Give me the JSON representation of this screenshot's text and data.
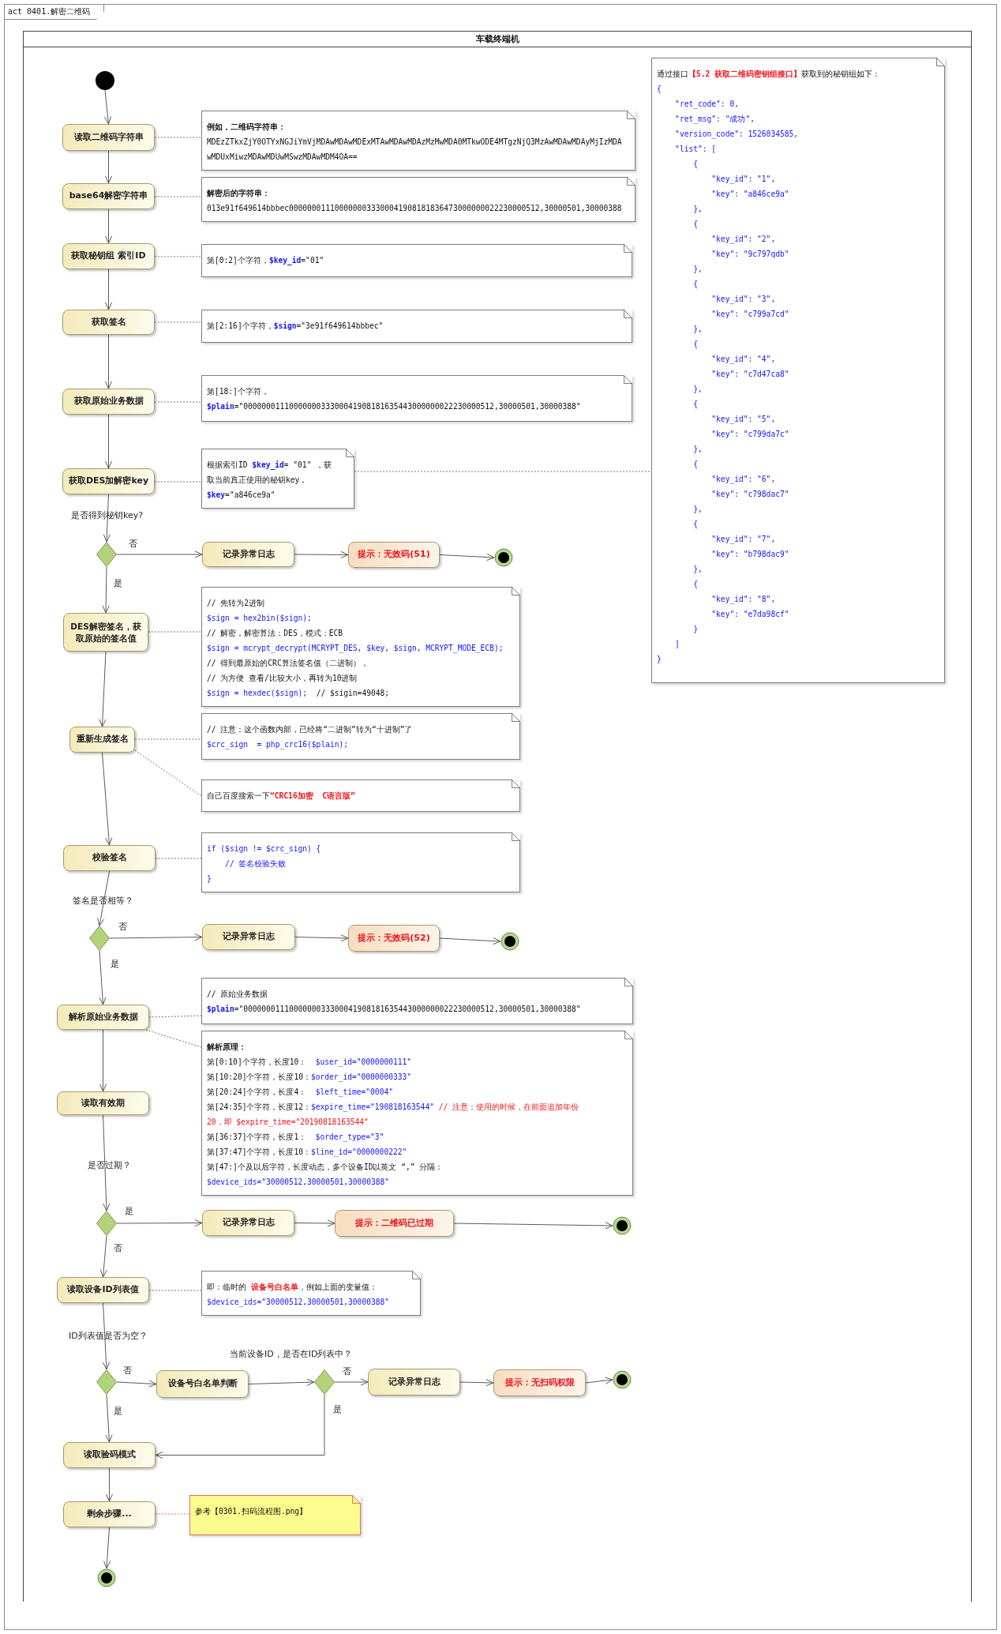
{
  "frame": {
    "title": "act 0401.解密二维码"
  },
  "swimlane": {
    "title": "车载终端机"
  },
  "nodes": [
    {
      "kind": "start"
    },
    {
      "kind": "action",
      "label": "读取二维码字符串"
    },
    {
      "kind": "action",
      "label": "base64解密字符串"
    },
    {
      "kind": "action",
      "label": "获取秘钥组 索引ID"
    },
    {
      "kind": "action",
      "label": "获取签名"
    },
    {
      "kind": "action",
      "label": "获取原始业务数据"
    },
    {
      "kind": "action",
      "label": "获取DES加解密key"
    },
    {
      "kind": "decision"
    },
    {
      "kind": "action",
      "label": "记录异常日志"
    },
    {
      "kind": "alert",
      "label": "提示：无效码(51)"
    },
    {
      "kind": "end"
    },
    {
      "kind": "action",
      "label": "DES解密签名，获取原始的签名值"
    },
    {
      "kind": "action",
      "label": "重新生成签名"
    },
    {
      "kind": "action",
      "label": "校验签名"
    },
    {
      "kind": "decision"
    },
    {
      "kind": "action",
      "label": "记录异常日志"
    },
    {
      "kind": "alert",
      "label": "提示：无效码(52)"
    },
    {
      "kind": "end"
    },
    {
      "kind": "action",
      "label": "解析原始业务数据"
    },
    {
      "kind": "action",
      "label": "读取有效期"
    },
    {
      "kind": "decision"
    },
    {
      "kind": "action",
      "label": "记录异常日志"
    },
    {
      "kind": "alert",
      "label": "提示：二维码已过期"
    },
    {
      "kind": "end"
    },
    {
      "kind": "action",
      "label": "读取设备ID列表值"
    },
    {
      "kind": "decision"
    },
    {
      "kind": "action",
      "label": "设备号白名单判断"
    },
    {
      "kind": "decision"
    },
    {
      "kind": "action",
      "label": "记录异常日志"
    },
    {
      "kind": "alert",
      "label": "提示：无扫码权限"
    },
    {
      "kind": "end"
    },
    {
      "kind": "action",
      "label": "读取验码模式"
    },
    {
      "kind": "action",
      "label": "剩余步骤..."
    },
    {
      "kind": "end"
    }
  ],
  "notes": [
    {
      "kind": "note",
      "lines": [
        [
          {
            "kind": "heading",
            "text": "例如，二维码字符串："
          }
        ],
        [
          {
            "kind": "text",
            "text": "MDEzZTkxZjY0OTYxNGJiYmVjMDAwMDAwMDExMTAwMDAwMDAzMzMwMDA0MTkwODE4MTgzNjQ3MzAwMDAwMDAyMjIzMDA"
          }
        ],
        [
          {
            "kind": "text",
            "text": "wMDUxMiwzMDAwMDUwMSwzMDAwMDM4OA=="
          }
        ]
      ]
    },
    {
      "kind": "note",
      "lines": [
        [
          {
            "kind": "heading",
            "text": "解密后的字符串："
          }
        ],
        [
          {
            "kind": "text",
            "text": "013e91f649614bbbec0000000111000000033300041908181836473000000022230000512,30000501,30000388"
          }
        ]
      ]
    },
    {
      "kind": "note",
      "lines": [
        [
          {
            "kind": "text",
            "text": "第[0:2]个字符，"
          },
          {
            "kind": "var",
            "text": "$key_id"
          },
          {
            "kind": "text",
            "text": "=\"01\""
          }
        ]
      ]
    },
    {
      "kind": "note",
      "lines": [
        [
          {
            "kind": "text",
            "text": "第[2:16]个字符，"
          },
          {
            "kind": "var",
            "text": "$sign"
          },
          {
            "kind": "text",
            "text": "=\"3e91f649614bbbec\""
          }
        ]
      ]
    },
    {
      "kind": "note",
      "lines": [
        [
          {
            "kind": "text",
            "text": "第[18:]个字符，"
          }
        ],
        [
          {
            "kind": "var",
            "text": "$plain"
          },
          {
            "kind": "text",
            "text": "=\"0000000111000000033300041908181635443000000022230000512,30000501,30000388\""
          }
        ]
      ]
    },
    {
      "kind": "note",
      "lines": [
        [
          {
            "kind": "text",
            "text": "根据索引ID "
          },
          {
            "kind": "var",
            "text": "$key_id"
          },
          {
            "kind": "text",
            "text": "= \"01\" ，获"
          }
        ],
        [
          {
            "kind": "text",
            "text": "取当前真正使用的秘钥key，"
          }
        ],
        [
          {
            "kind": "var",
            "text": "$key"
          },
          {
            "kind": "text",
            "text": "=\"a846ce9a\""
          }
        ]
      ]
    },
    {
      "kind": "note",
      "lines": [
        [
          {
            "kind": "text",
            "text": "通过接口"
          },
          {
            "kind": "alert",
            "text": "【5.2 获取二维码密钥组接口】"
          },
          {
            "kind": "text",
            "text": "获取到的秘钥组如下："
          }
        ],
        [
          {
            "kind": "code",
            "text": "{"
          }
        ],
        [
          {
            "kind": "code",
            "text": "    \"ret_code\": 0,"
          }
        ],
        [
          {
            "kind": "code",
            "text": "    \"ret_msg\": \"成功\","
          }
        ],
        [
          {
            "kind": "code",
            "text": "    \"version_code\": 1526034585,"
          }
        ],
        [
          {
            "kind": "code",
            "text": "    \"list\": ["
          }
        ],
        [
          {
            "kind": "code",
            "text": "        {"
          }
        ],
        [
          {
            "kind": "code",
            "text": "            \"key_id\": \"1\","
          }
        ],
        [
          {
            "kind": "code",
            "text": "            \"key\": \"a846ce9a\""
          }
        ],
        [
          {
            "kind": "code",
            "text": "        },"
          }
        ],
        [
          {
            "kind": "code",
            "text": "        {"
          }
        ],
        [
          {
            "kind": "code",
            "text": "            \"key_id\": \"2\","
          }
        ],
        [
          {
            "kind": "code",
            "text": "            \"key\": \"9c797qdb\""
          }
        ],
        [
          {
            "kind": "code",
            "text": "        },"
          }
        ],
        [
          {
            "kind": "code",
            "text": "        {"
          }
        ],
        [
          {
            "kind": "code",
            "text": "            \"key_id\": \"3\","
          }
        ],
        [
          {
            "kind": "code",
            "text": "            \"key\": \"c799a7cd\""
          }
        ],
        [
          {
            "kind": "code",
            "text": "        },"
          }
        ],
        [
          {
            "kind": "code",
            "text": "        {"
          }
        ],
        [
          {
            "kind": "code",
            "text": "            \"key_id\": \"4\","
          }
        ],
        [
          {
            "kind": "code",
            "text": "            \"key\": \"c7d47ca8\""
          }
        ],
        [
          {
            "kind": "code",
            "text": "        },"
          }
        ],
        [
          {
            "kind": "code",
            "text": "        {"
          }
        ],
        [
          {
            "kind": "code",
            "text": "            \"key_id\": \"5\","
          }
        ],
        [
          {
            "kind": "code",
            "text": "            \"key\": \"c799da7c\""
          }
        ],
        [
          {
            "kind": "code",
            "text": "        },"
          }
        ],
        [
          {
            "kind": "code",
            "text": "        {"
          }
        ],
        [
          {
            "kind": "code",
            "text": "            \"key_id\": \"6\","
          }
        ],
        [
          {
            "kind": "code",
            "text": "            \"key\": \"c798dac7\""
          }
        ],
        [
          {
            "kind": "code",
            "text": "        },"
          }
        ],
        [
          {
            "kind": "code",
            "text": "        {"
          }
        ],
        [
          {
            "kind": "code",
            "text": "            \"key_id\": \"7\","
          }
        ],
        [
          {
            "kind": "code",
            "text": "            \"key\": \"b798dac9\""
          }
        ],
        [
          {
            "kind": "code",
            "text": "        },"
          }
        ],
        [
          {
            "kind": "code",
            "text": "        {"
          }
        ],
        [
          {
            "kind": "code",
            "text": "            \"key_id\": \"8\","
          }
        ],
        [
          {
            "kind": "code",
            "text": "            \"key\": \"e7da98cf\""
          }
        ],
        [
          {
            "kind": "code",
            "text": "        }"
          }
        ],
        [
          {
            "kind": "code",
            "text": "    ]"
          }
        ],
        [
          {
            "kind": "code",
            "text": "}"
          }
        ]
      ]
    },
    {
      "kind": "note",
      "lines": [
        [
          {
            "kind": "text",
            "text": "// 先转为2进制"
          }
        ],
        [
          {
            "kind": "code",
            "text": "$sign = hex2bin($sign);"
          }
        ],
        [
          {
            "kind": "text",
            "text": "// 解密，解密算法：DES，模式：ECB"
          }
        ],
        [
          {
            "kind": "code",
            "text": "$sign = mcrypt_decrypt(MCRYPT_DES, $key, $sign, MCRYPT_MODE_ECB);"
          }
        ],
        [
          {
            "kind": "text",
            "text": "// 得到最原始的CRC算法签名值（二进制），"
          }
        ],
        [
          {
            "kind": "text",
            "text": "// 为方便 查看/比较大小，再转为10进制"
          }
        ],
        [
          {
            "kind": "code",
            "text": "$sign = hexdec($sign);"
          },
          {
            "kind": "text",
            "text": "  // $sigin=49048;"
          }
        ]
      ]
    },
    {
      "kind": "note",
      "lines": [
        [
          {
            "kind": "text",
            "text": "// 注意：这个函数内部，已经将“二进制”转为“十进制”了"
          }
        ],
        [
          {
            "kind": "code",
            "text": "$crc_sign  = php_crc16($plain);"
          }
        ]
      ]
    },
    {
      "kind": "note",
      "lines": [
        [
          {
            "kind": "text",
            "text": "自己百度搜索一下"
          },
          {
            "kind": "alert",
            "text": "“CRC16加密  C语言版”"
          }
        ]
      ]
    },
    {
      "kind": "note",
      "lines": [
        [
          {
            "kind": "code",
            "text": "if ($sign != $crc_sign) {"
          }
        ],
        [
          {
            "kind": "code",
            "text": "    // 签名校验失败"
          }
        ],
        [
          {
            "kind": "code",
            "text": "}"
          }
        ]
      ]
    },
    {
      "kind": "note",
      "lines": [
        [
          {
            "kind": "text",
            "text": "// 原始业务数据"
          }
        ],
        [
          {
            "kind": "var",
            "text": "$plain"
          },
          {
            "kind": "text",
            "text": "=\"0000000111000000033300041908181635443000000022230000512,30000501,30000388\""
          }
        ]
      ]
    },
    {
      "kind": "note",
      "lines": [
        [
          {
            "kind": "heading",
            "text": "解析原理："
          }
        ],
        [
          {
            "kind": "text",
            "text": "第[0:10]个字符，长度10：  "
          },
          {
            "kind": "code",
            "text": "$user_id=\"0000000111\""
          }
        ],
        [
          {
            "kind": "text",
            "text": "第[10:20]个字符，长度10："
          },
          {
            "kind": "code",
            "text": "$order_id=\"0000000333\""
          }
        ],
        [
          {
            "kind": "text",
            "text": "第[20:24]个字符，长度4：  "
          },
          {
            "kind": "code",
            "text": "$left_time=\"0004\""
          }
        ],
        [
          {
            "kind": "text",
            "text": "第[24:35]个字符，长度12："
          },
          {
            "kind": "code",
            "text": "$expire_time=\"190818163544\""
          },
          {
            "kind": "warn",
            "text": " // 注意：使用的时候，在前面追加年份"
          }
        ],
        [
          {
            "kind": "warn",
            "text": "20，即 $expire_time=\"20190818163544\""
          }
        ],
        [
          {
            "kind": "text",
            "text": "第[36:37]个字符，长度1：  "
          },
          {
            "kind": "code",
            "text": "$order_type=\"3\""
          }
        ],
        [
          {
            "kind": "text",
            "text": "第[37:47]个字符，长度10："
          },
          {
            "kind": "code",
            "text": "$line_id=\"0000000222\""
          }
        ],
        [
          {
            "kind": "text",
            "text": "第[47:]个及以后字符，长度动态，多个设备ID以英文 “,” 分隔："
          }
        ],
        [
          {
            "kind": "code",
            "text": "$device_ids=\"30000512,30000501,30000388\""
          }
        ]
      ]
    },
    {
      "kind": "note",
      "lines": [
        [
          {
            "kind": "text",
            "text": "即：临时的 "
          },
          {
            "kind": "alert",
            "text": "设备号白名单"
          },
          {
            "kind": "text",
            "text": "，例如上面的变量值："
          }
        ],
        [
          {
            "kind": "code",
            "text": "$device_ids=\"30000512,30000501,30000388\""
          }
        ]
      ]
    },
    {
      "kind": "sticky",
      "lines": [
        [
          {
            "kind": "text",
            "text": "参考【0301.扫码流程图.png】"
          }
        ]
      ]
    }
  ],
  "labels": [
    "是否得到秘钥key?",
    "否",
    "是",
    "签名是否相等？",
    "否",
    "是",
    "是否过期？",
    "是",
    "否",
    "ID列表值是否为空？",
    "当前设备ID，是否在ID列表中？",
    "否",
    "否",
    "是",
    "是"
  ]
}
